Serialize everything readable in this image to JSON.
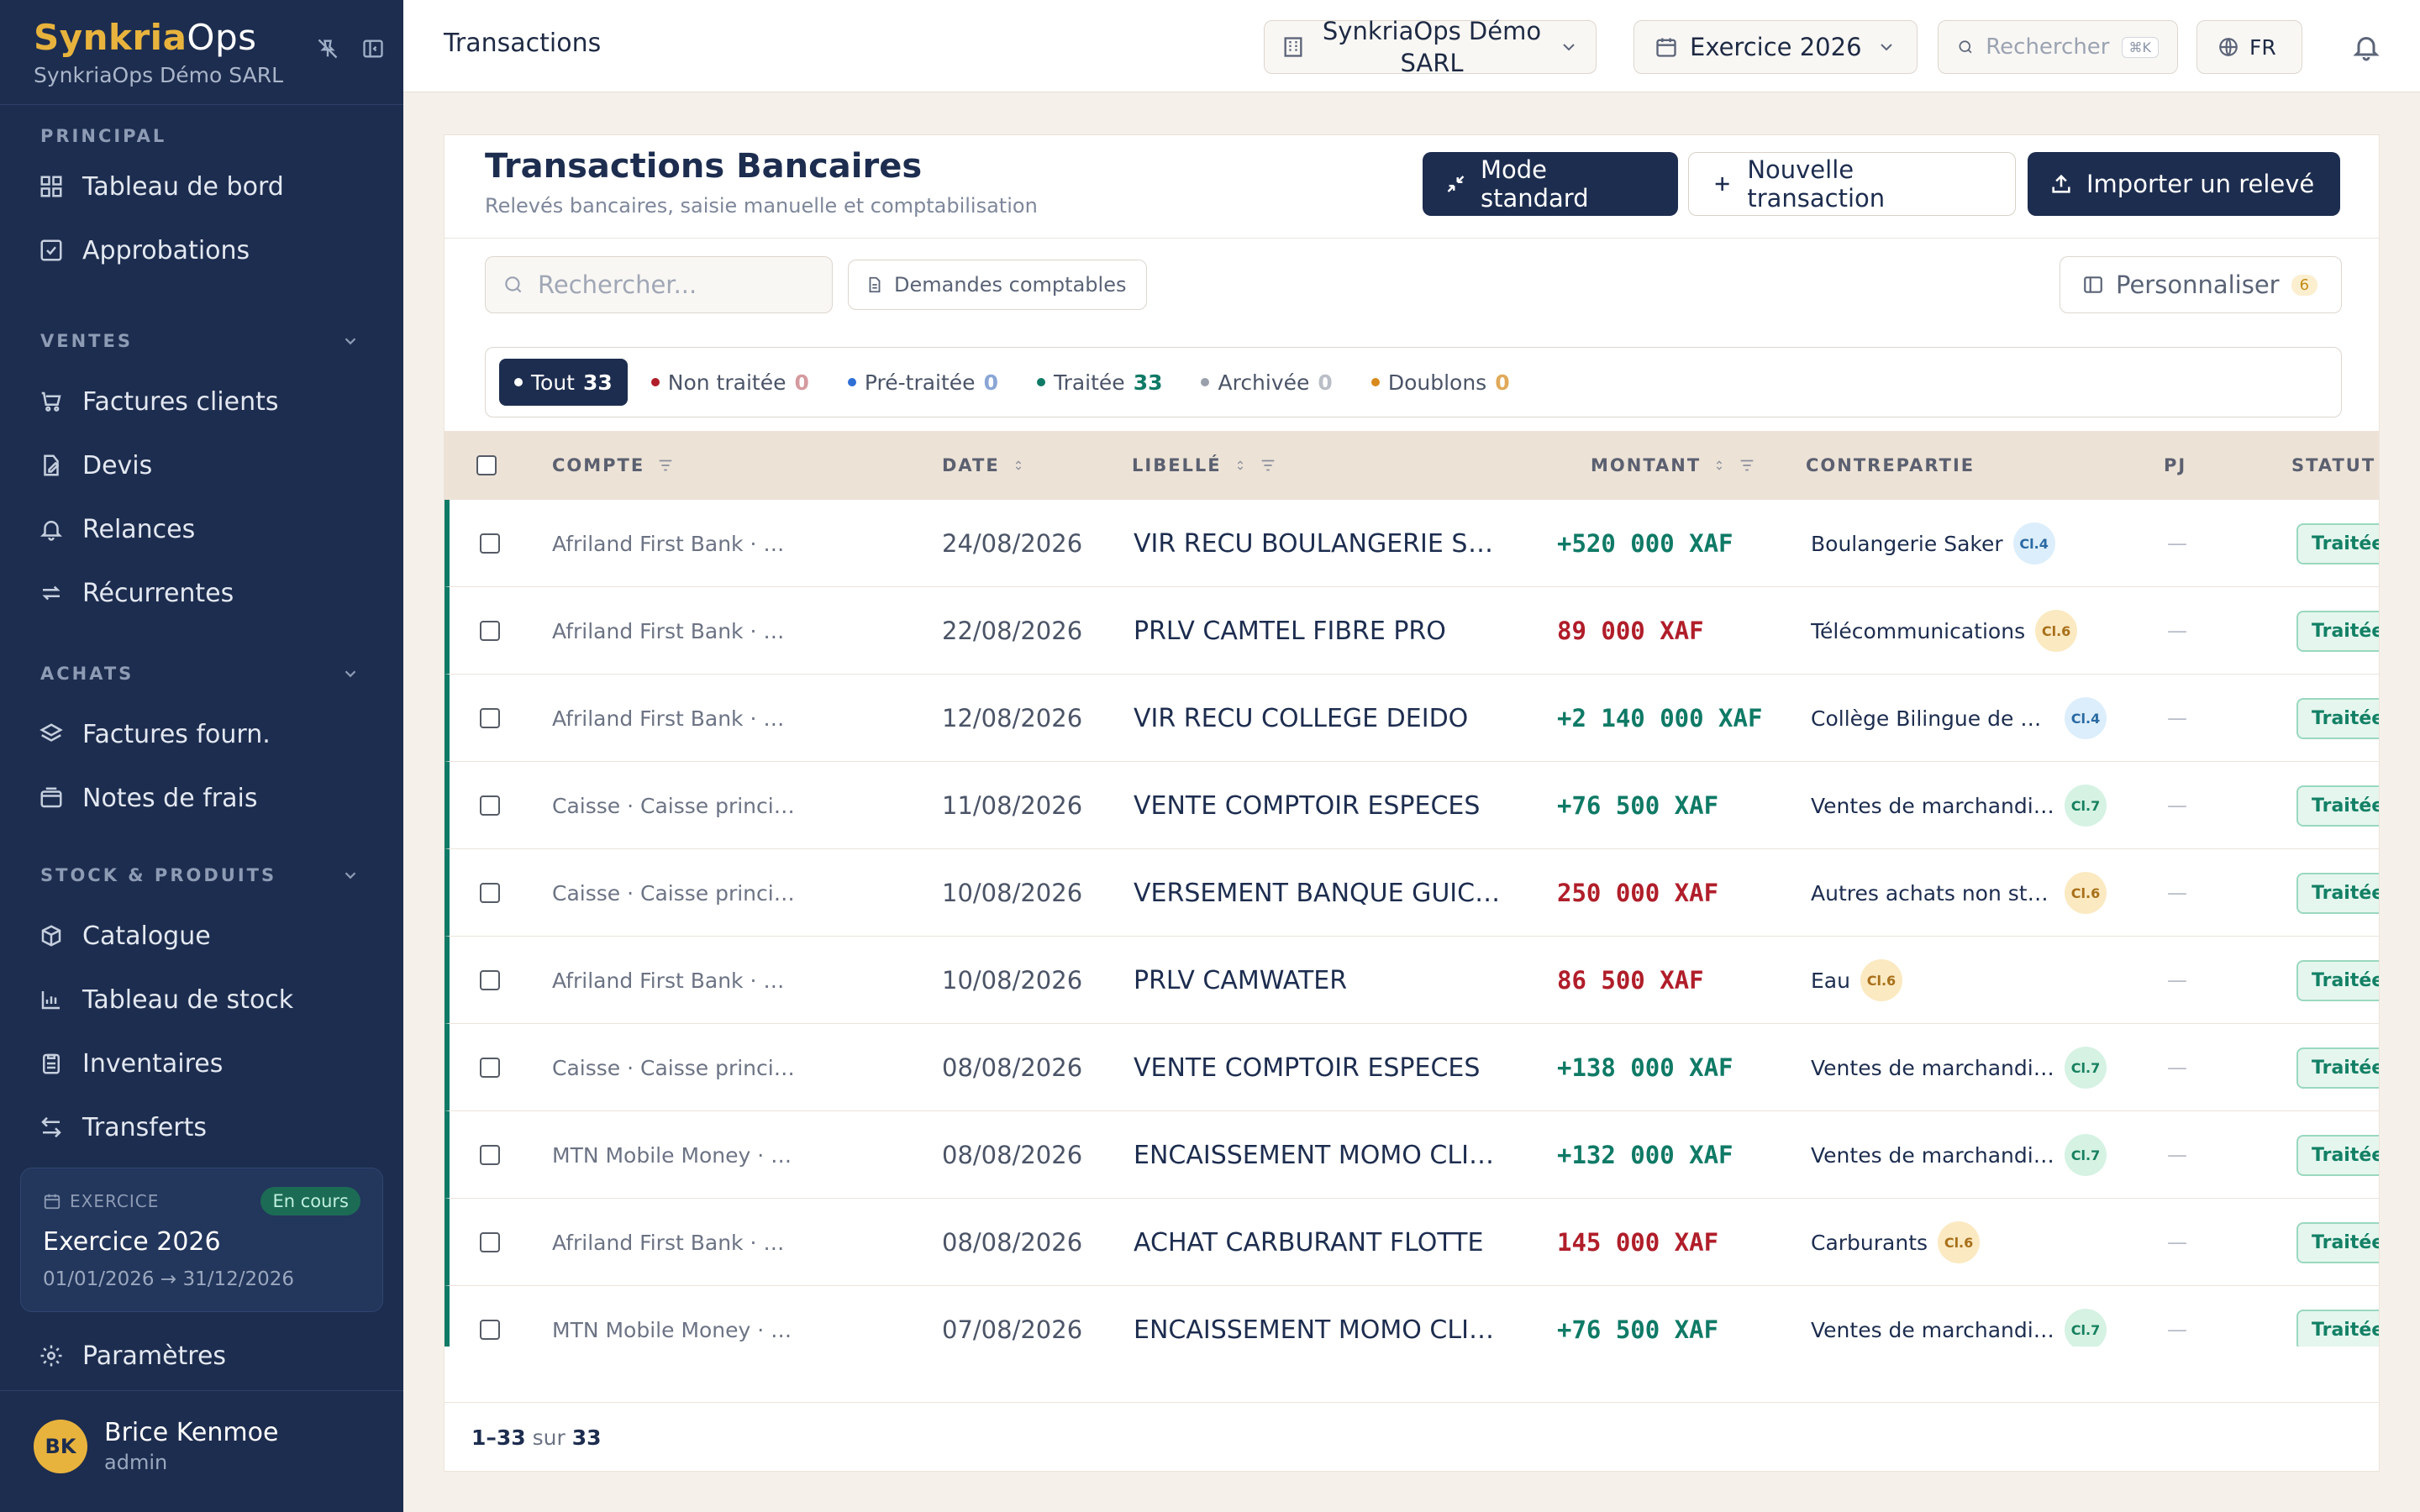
{
  "sidebar": {
    "brand_part1": "Synkria",
    "brand_part2": "Ops",
    "company": "SynkriaOps Démo SARL",
    "sections": {
      "principal": {
        "title": "PRINCIPAL",
        "items": [
          {
            "label": "Tableau de bord",
            "icon": "dashboard-icon"
          },
          {
            "label": "Approbations",
            "icon": "check-square-icon"
          }
        ]
      },
      "ventes": {
        "title": "VENTES",
        "items": [
          {
            "label": "Factures clients",
            "icon": "cart-icon"
          },
          {
            "label": "Devis",
            "icon": "edit-doc-icon"
          },
          {
            "label": "Relances",
            "icon": "bell-ring-icon"
          },
          {
            "label": "Récurrentes",
            "icon": "repeat-icon"
          }
        ]
      },
      "achats": {
        "title": "ACHATS",
        "items": [
          {
            "label": "Factures fourn.",
            "icon": "layers-icon"
          },
          {
            "label": "Notes de frais",
            "icon": "wallet-icon"
          }
        ]
      },
      "stock": {
        "title": "STOCK & PRODUITS",
        "items": [
          {
            "label": "Catalogue",
            "icon": "box-icon"
          },
          {
            "label": "Tableau de stock",
            "icon": "bar-chart-icon"
          },
          {
            "label": "Inventaires",
            "icon": "clipboard-icon"
          },
          {
            "label": "Transferts",
            "icon": "arrows-icon"
          }
        ]
      }
    },
    "exercise": {
      "label": "EXERCICE",
      "badge": "En cours",
      "title": "Exercice 2026",
      "dates": "01/01/2026 → 31/12/2026"
    },
    "settings_label": "Paramètres",
    "user": {
      "initials": "BK",
      "name": "Brice Kenmoe",
      "role": "admin"
    }
  },
  "topbar": {
    "title": "Transactions",
    "company": "SynkriaOps Démo SARL",
    "year": "Exercice 2026",
    "search_placeholder": "Rechercher",
    "shortcut": "⌘K",
    "lang": "FR"
  },
  "page": {
    "title": "Transactions Bancaires",
    "subtitle": "Relevés bancaires, saisie manuelle et comptabilisation",
    "btn_mode": "Mode standard",
    "btn_new": "Nouvelle transaction",
    "btn_import": "Importer un relevé",
    "search_placeholder": "Rechercher...",
    "btn_demandes": "Demandes comptables",
    "btn_perso": "Personnaliser",
    "perso_count": "6"
  },
  "filters": [
    {
      "label": "Tout",
      "count": "33",
      "active": true,
      "color": "#ffffff"
    },
    {
      "label": "Non traitée",
      "count": "0",
      "color": "#b01e2a"
    },
    {
      "label": "Pré-traitée",
      "count": "0",
      "color": "#2f6fd6"
    },
    {
      "label": "Traitée",
      "count": "33",
      "color": "#0f7a66"
    },
    {
      "label": "Archivée",
      "count": "0",
      "color": "#9aa0ab"
    },
    {
      "label": "Doublons",
      "count": "0",
      "color": "#d98a1c"
    }
  ],
  "table": {
    "headers": {
      "compte": "COMPTE",
      "date": "DATE",
      "libelle": "LIBELLÉ",
      "montant": "MONTANT",
      "contrepartie": "CONTREPARTIE",
      "pj": "PJ",
      "statut": "STATUT"
    },
    "rows": [
      {
        "compte": "Afriland First Bank · Compte co...",
        "date": "24/08/2026",
        "libelle": "VIR RECU BOULANGERIE SAK...",
        "montant": "+520 000 XAF",
        "sign": "pos",
        "contrepartie": "Boulangerie Saker",
        "cl": "Cl.4",
        "pj": "—",
        "statut": "Traitée"
      },
      {
        "compte": "Afriland First Bank · Compte co...",
        "date": "22/08/2026",
        "libelle": "PRLV CAMTEL FIBRE PRO",
        "montant": "89 000 XAF",
        "sign": "neg",
        "contrepartie": "Télécommunications",
        "cl": "Cl.6",
        "pj": "—",
        "statut": "Traitée"
      },
      {
        "compte": "Afriland First Bank · Compte co...",
        "date": "12/08/2026",
        "libelle": "VIR RECU COLLEGE DEIDO",
        "montant": "+2 140 000 XAF",
        "sign": "pos",
        "contrepartie": "Collège Bilingue de De...",
        "cl": "Cl.4",
        "pj": "—",
        "statut": "Traitée"
      },
      {
        "compte": "Caisse · Caisse principale Akwa",
        "date": "11/08/2026",
        "libelle": "VENTE COMPTOIR ESPECES",
        "montant": "+76 500 XAF",
        "sign": "pos",
        "contrepartie": "Ventes de marchandises",
        "cl": "Cl.7",
        "pj": "—",
        "statut": "Traitée"
      },
      {
        "compte": "Caisse · Caisse principale Akwa",
        "date": "10/08/2026",
        "libelle": "VERSEMENT BANQUE GUICH...",
        "montant": "250 000 XAF",
        "sign": "neg",
        "contrepartie": "Autres achats non sto...",
        "cl": "Cl.6",
        "pj": "—",
        "statut": "Traitée"
      },
      {
        "compte": "Afriland First Bank · Compte co...",
        "date": "10/08/2026",
        "libelle": "PRLV CAMWATER",
        "montant": "86 500 XAF",
        "sign": "neg",
        "contrepartie": "Eau",
        "cl": "Cl.6",
        "pj": "—",
        "statut": "Traitée"
      },
      {
        "compte": "Caisse · Caisse principale Akwa",
        "date": "08/08/2026",
        "libelle": "VENTE COMPTOIR ESPECES",
        "montant": "+138 000 XAF",
        "sign": "pos",
        "contrepartie": "Ventes de marchandises",
        "cl": "Cl.7",
        "pj": "—",
        "statut": "Traitée"
      },
      {
        "compte": "MTN Mobile Money · Wallet MT...",
        "date": "08/08/2026",
        "libelle": "ENCAISSEMENT MOMO CLIEN...",
        "montant": "+132 000 XAF",
        "sign": "pos",
        "contrepartie": "Ventes de marchandises",
        "cl": "Cl.7",
        "pj": "—",
        "statut": "Traitée"
      },
      {
        "compte": "Afriland First Bank · Compte co...",
        "date": "08/08/2026",
        "libelle": "ACHAT CARBURANT FLOTTE",
        "montant": "145 000 XAF",
        "sign": "neg",
        "contrepartie": "Carburants",
        "cl": "Cl.6",
        "pj": "—",
        "statut": "Traitée"
      },
      {
        "compte": "MTN Mobile Money · Wallet MT...",
        "date": "07/08/2026",
        "libelle": "ENCAISSEMENT MOMO CLIEN...",
        "montant": "+76 500 XAF",
        "sign": "pos",
        "contrepartie": "Ventes de marchandises",
        "cl": "Cl.7",
        "pj": "—",
        "statut": "Traitée"
      }
    ]
  },
  "pagination": {
    "range": "1–33",
    "of": "sur",
    "total": "33"
  }
}
